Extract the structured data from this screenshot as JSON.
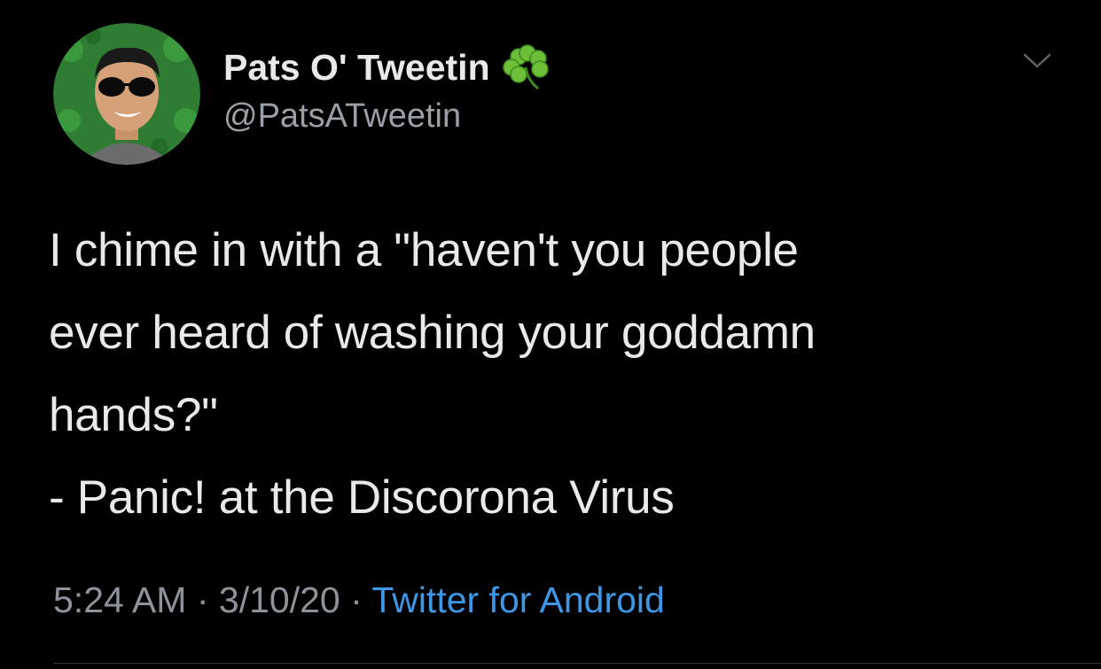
{
  "tweet": {
    "display_name": "Pats O' Tweetin",
    "handle": "@PatsATweetin",
    "text": "I chime in with a \"haven't you people\never heard of washing your goddamn\nhands?\"\n- Panic! at the Discorona Virus",
    "time": "5:24 AM",
    "date": "3/10/20",
    "separator": "·",
    "source": "Twitter for Android"
  },
  "icons": {
    "avatar": "avatar-cartoon-man-sunglasses",
    "name_emoji": "shamrock-icon",
    "menu": "chevron-down-icon"
  },
  "colors": {
    "background": "#000000",
    "text": "#e7e9ea",
    "secondary": "#9aa0a6",
    "link": "#3e97e6",
    "shamrock": "#6dbf3a"
  }
}
